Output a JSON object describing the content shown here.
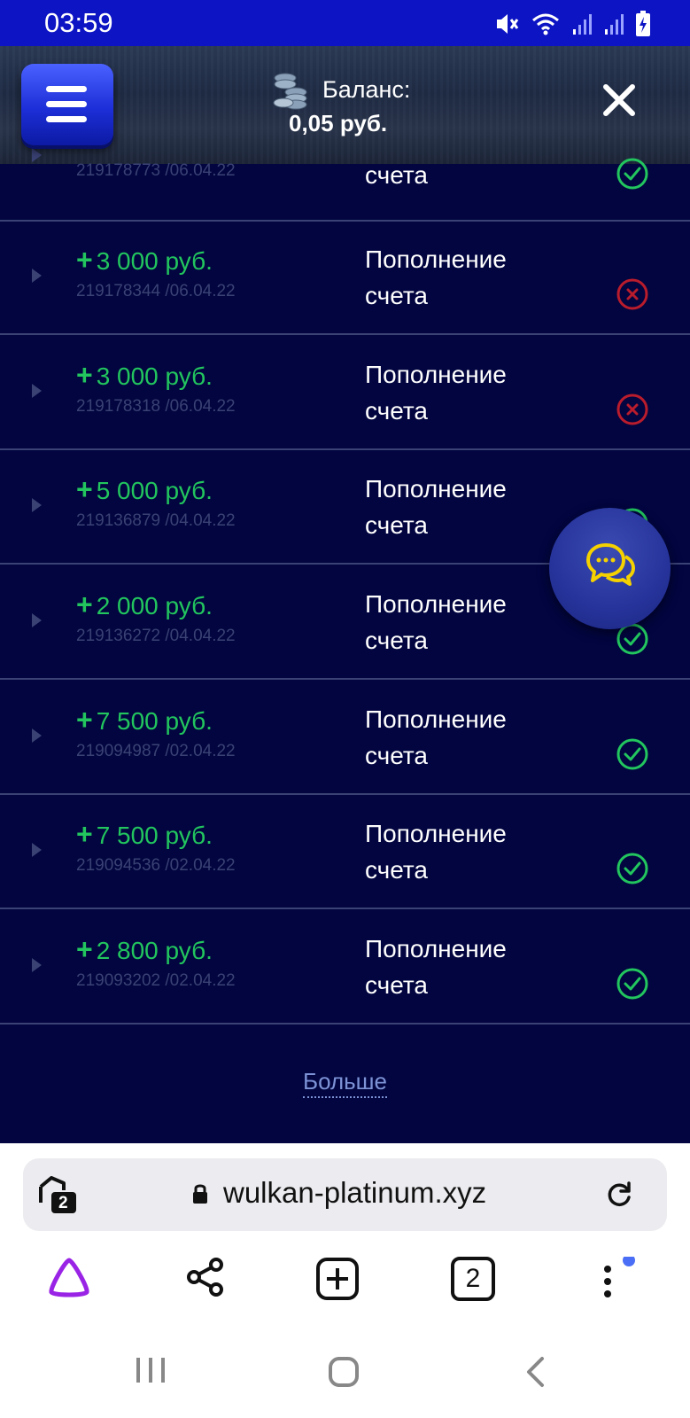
{
  "status_bar": {
    "time": "03:59"
  },
  "header": {
    "balance_label": "Баланс:",
    "balance_value": "0,05 руб.",
    "menu_icon": "hamburger-menu-icon",
    "close_icon": "close-icon"
  },
  "transactions": [
    {
      "amount": "",
      "id_date": "219178773 /06.04.22",
      "desc_line1": "",
      "desc_line2": "счета",
      "status": "success"
    },
    {
      "amount": "3 000 руб.",
      "id_date": "219178344 /06.04.22",
      "desc_line1": "Пополнение",
      "desc_line2": "счета",
      "status": "failed"
    },
    {
      "amount": "3 000 руб.",
      "id_date": "219178318 /06.04.22",
      "desc_line1": "Пополнение",
      "desc_line2": "счета",
      "status": "failed"
    },
    {
      "amount": "5 000 руб.",
      "id_date": "219136879 /04.04.22",
      "desc_line1": "Пополнение",
      "desc_line2": "счета",
      "status": "success"
    },
    {
      "amount": "2 000 руб.",
      "id_date": "219136272 /04.04.22",
      "desc_line1": "Пополнение",
      "desc_line2": "счета",
      "status": "success"
    },
    {
      "amount": "7 500 руб.",
      "id_date": "219094987 /02.04.22",
      "desc_line1": "Пополнение",
      "desc_line2": "счета",
      "status": "success"
    },
    {
      "amount": "7 500 руб.",
      "id_date": "219094536 /02.04.22",
      "desc_line1": "Пополнение",
      "desc_line2": "счета",
      "status": "success"
    },
    {
      "amount": "2 800 руб.",
      "id_date": "219093202 /02.04.22",
      "desc_line1": "Пополнение",
      "desc_line2": "счета",
      "status": "success"
    }
  ],
  "amount_prefix": "+",
  "more_link": "Больше",
  "browser": {
    "tab_count": "2",
    "url": "wulkan-platinum.xyz",
    "toolbar_tab_count": "2"
  },
  "colors": {
    "background": "#02053f",
    "status_bar": "#0d14c4",
    "amount_green": "#22c55e",
    "success_green": "#22c55e",
    "failed_red": "#b91c2c",
    "muted_text": "#3a4274"
  }
}
